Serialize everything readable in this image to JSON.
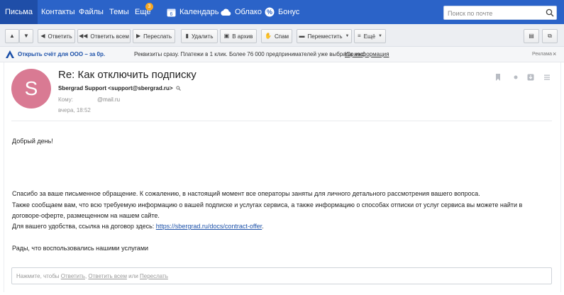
{
  "nav": {
    "items": [
      {
        "label": "Письма",
        "active": true
      },
      {
        "label": "Контакты"
      },
      {
        "label": "Файлы"
      },
      {
        "label": "Темы"
      },
      {
        "label": "Ещё",
        "badge": "3"
      }
    ],
    "services": [
      {
        "label": "Календарь",
        "icon": "calendar-icon",
        "icon_text": "6"
      },
      {
        "label": "Облако",
        "icon": "cloud-icon"
      },
      {
        "label": "Бонус",
        "icon": "bonus-icon"
      }
    ],
    "search_placeholder": "Поиск по почте",
    "colors": {
      "bar": "#2b63c8",
      "active": "#1f4ea8",
      "badge": "#f5a623"
    }
  },
  "toolbar": {
    "reply": "Ответить",
    "reply_all": "Ответить всем",
    "forward": "Переслать",
    "delete": "Удалить",
    "archive": "В архив",
    "spam": "Спам",
    "move": "Переместить",
    "more": "Ещё"
  },
  "ad": {
    "link": "Открыть счёт для ООО – за 0р.",
    "text": "Реквизиты сразу. Платежи в 1 клик. Более 76 000 предпринимателей уже выбрали нас!",
    "info": "Юр.информация",
    "label": "Реклама",
    "close": "×"
  },
  "message": {
    "avatar_letter": "S",
    "avatar_color": "#d97a93",
    "subject": "Re: Как отключить подписку",
    "sender": "Sbergrad Support <support@sbergrad.ru>",
    "to_label": "Кому:",
    "to_value": "@mail.ru",
    "date": "вчера, 18:52",
    "greeting": "Добрый день!",
    "para1": "Спасибо за ваше письменное обращение. К сожалению, в настоящий момент все операторы заняты для личного детального рассмотрения вашего вопроса.",
    "para2": "Также сообщаем вам, что всю требуемую информацию о вашей подписке и услугах сервиса, а также информацию о способах отписки от услуг сервиса вы можете найти в",
    "para3": "договоре-оферте, размещенном на нашем сайте.",
    "para4_prefix": "Для вашего удобства, ссылка на договор здесь: ",
    "para4_link": "https://sbergrad.ru/docs/contract-offer",
    "para4_suffix": ".",
    "closing": "Рады, что воспользовались нашими услугами"
  },
  "reply": {
    "prefix": "Нажмите, чтобы ",
    "reply": "Ответить",
    "sep1": ", ",
    "reply_all": "Ответить всем",
    "sep2": " или ",
    "forward": "Переслать"
  }
}
